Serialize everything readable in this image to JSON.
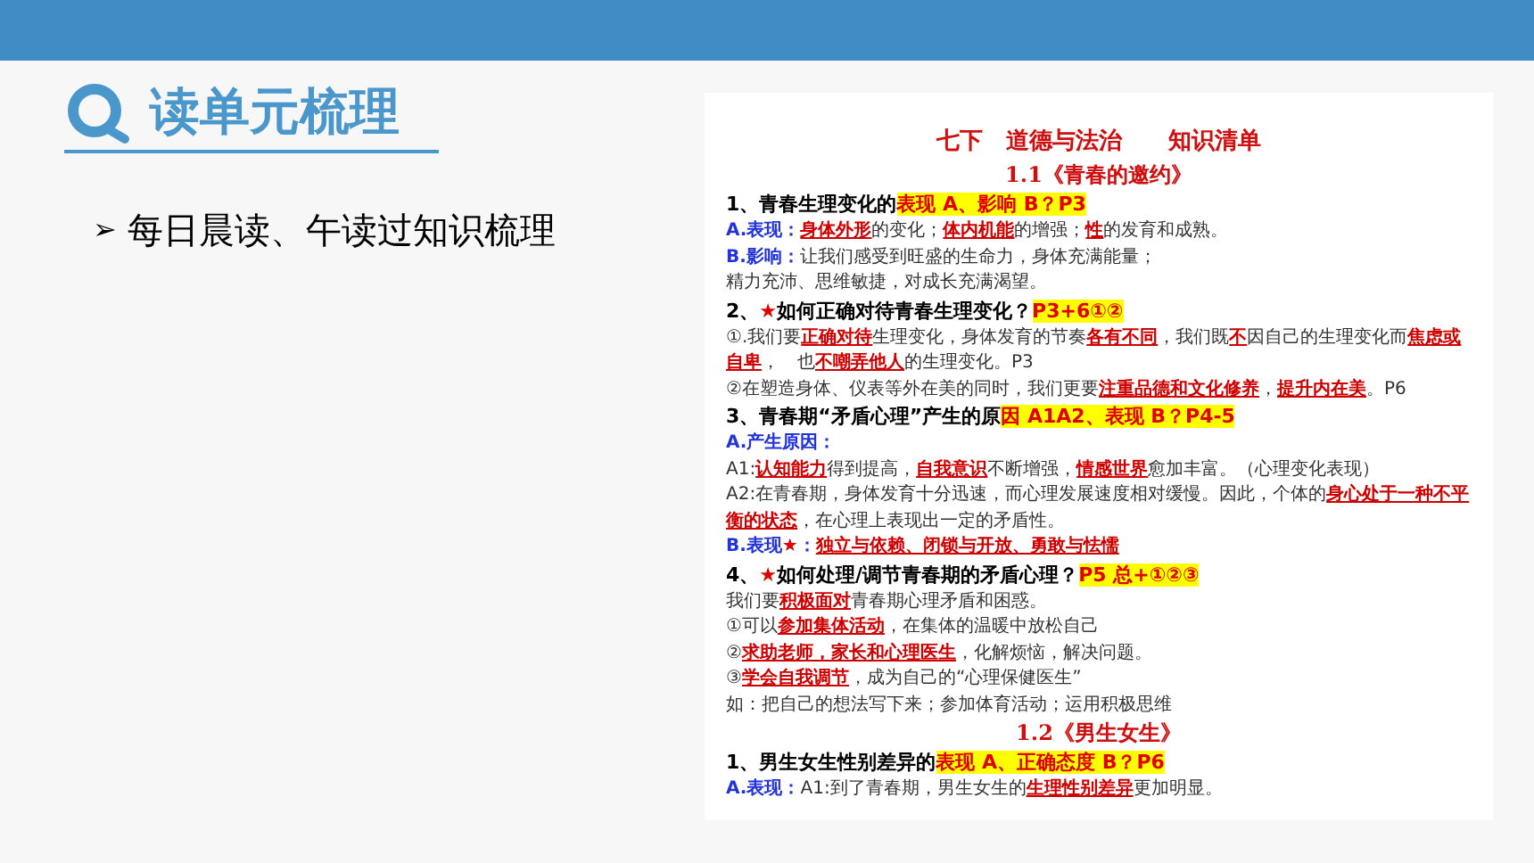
{
  "slide": {
    "title": "读单元梳理",
    "bullet": {
      "marker": "➢",
      "text": "每日晨读、午读过知识梳理"
    }
  },
  "document": {
    "title": "七下　道德与法治　　知识清单",
    "blocks": [
      {
        "kind": "section",
        "segments": [
          {
            "kind": "plain",
            "text": "1.1《青春的邀约》"
          }
        ]
      },
      {
        "kind": "heading",
        "segments": [
          {
            "kind": "plain",
            "text": "1、青春生理变化的"
          },
          {
            "kind": "hl",
            "text": "表现 A、影响 B？P3"
          }
        ]
      },
      {
        "kind": "text",
        "segments": [
          {
            "kind": "label",
            "text": "A.表现："
          },
          {
            "kind": "key",
            "text": "身体外形"
          },
          {
            "kind": "plain",
            "text": "的变化；"
          },
          {
            "kind": "key",
            "text": "体内机能"
          },
          {
            "kind": "plain",
            "text": "的增强；"
          },
          {
            "kind": "key",
            "text": "性"
          },
          {
            "kind": "plain",
            "text": "的发育和成熟。"
          }
        ]
      },
      {
        "kind": "text",
        "segments": [
          {
            "kind": "label",
            "text": "B.影响："
          },
          {
            "kind": "plain",
            "text": "让我们感受到旺盛的生命力，身体充满能量；"
          }
        ]
      },
      {
        "kind": "text",
        "segments": [
          {
            "kind": "plain",
            "text": "精力充沛、思维敏捷，对成长充满渴望。"
          }
        ]
      },
      {
        "kind": "heading",
        "segments": [
          {
            "kind": "plain",
            "text": "2、"
          },
          {
            "kind": "star",
            "text": "★"
          },
          {
            "kind": "plain",
            "text": "如何正确对待青春生理变化？"
          },
          {
            "kind": "hl",
            "text": "P3+6①②"
          }
        ]
      },
      {
        "kind": "text",
        "segments": [
          {
            "kind": "plain",
            "text": "①.我们要"
          },
          {
            "kind": "key",
            "text": "正确对待"
          },
          {
            "kind": "plain",
            "text": "生理变化，身体发育的节奏"
          },
          {
            "kind": "key",
            "text": "各有不同"
          },
          {
            "kind": "plain",
            "text": "，我们既"
          },
          {
            "kind": "key",
            "text": "不"
          },
          {
            "kind": "plain",
            "text": "因自己的生理变化而"
          },
          {
            "kind": "key",
            "text": "焦虑或自卑"
          },
          {
            "kind": "plain",
            "text": "，　也"
          },
          {
            "kind": "key",
            "text": "不嘲弄他人"
          },
          {
            "kind": "plain",
            "text": "的生理变化。P3"
          }
        ]
      },
      {
        "kind": "text",
        "segments": [
          {
            "kind": "plain",
            "text": "②在塑造身体、仪表等外在美的同时，我们更要"
          },
          {
            "kind": "key",
            "text": "注重品德和文化修养"
          },
          {
            "kind": "plain",
            "text": "，"
          },
          {
            "kind": "key",
            "text": "提升内在美"
          },
          {
            "kind": "plain",
            "text": "。P6"
          }
        ]
      },
      {
        "kind": "heading",
        "segments": [
          {
            "kind": "plain",
            "text": "3、青春期“矛盾心理”产生的原"
          },
          {
            "kind": "hl",
            "text": "因 A1A2、表现 B？P4-5"
          }
        ]
      },
      {
        "kind": "text",
        "segments": [
          {
            "kind": "label",
            "text": "A.产生原因："
          }
        ]
      },
      {
        "kind": "text",
        "segments": [
          {
            "kind": "plain",
            "text": "A1:"
          },
          {
            "kind": "key",
            "text": "认知能力"
          },
          {
            "kind": "plain",
            "text": "得到提高，"
          },
          {
            "kind": "key",
            "text": "自我意识"
          },
          {
            "kind": "plain",
            "text": "不断增强，"
          },
          {
            "kind": "key",
            "text": "情感世界"
          },
          {
            "kind": "plain",
            "text": "愈加丰富。（心理变化表现）"
          }
        ]
      },
      {
        "kind": "text",
        "segments": [
          {
            "kind": "plain",
            "text": "A2:在青春期，身体发育十分迅速，而心理发展速度相对缓慢。因此，个体的"
          },
          {
            "kind": "key",
            "text": "身心处于一种不平衡的状态"
          },
          {
            "kind": "plain",
            "text": "，在心理上表现出一定的矛盾性。"
          }
        ]
      },
      {
        "kind": "text",
        "segments": [
          {
            "kind": "label",
            "text": "B.表现"
          },
          {
            "kind": "star",
            "text": "★"
          },
          {
            "kind": "label",
            "text": "："
          },
          {
            "kind": "key",
            "text": "独立与依赖、闭锁与开放、勇敢与怯懦"
          }
        ]
      },
      {
        "kind": "heading",
        "segments": [
          {
            "kind": "plain",
            "text": "4、"
          },
          {
            "kind": "star",
            "text": "★"
          },
          {
            "kind": "plain",
            "text": "如何处理/调节青春期的矛盾心理？"
          },
          {
            "kind": "hl",
            "text": "P5 总+①②③"
          }
        ]
      },
      {
        "kind": "text",
        "segments": [
          {
            "kind": "plain",
            "text": "我们要"
          },
          {
            "kind": "key",
            "text": "积极面对"
          },
          {
            "kind": "plain",
            "text": "青春期心理矛盾和困惑。"
          }
        ]
      },
      {
        "kind": "text",
        "segments": [
          {
            "kind": "plain",
            "text": "①可以"
          },
          {
            "kind": "key",
            "text": "参加集体活动"
          },
          {
            "kind": "plain",
            "text": "，在集体的温暖中放松自己"
          }
        ]
      },
      {
        "kind": "text",
        "segments": [
          {
            "kind": "plain",
            "text": "②"
          },
          {
            "kind": "key",
            "text": "求助老师，家长和心理医生"
          },
          {
            "kind": "plain",
            "text": "，化解烦恼，解决问题。"
          }
        ]
      },
      {
        "kind": "text",
        "segments": [
          {
            "kind": "plain",
            "text": "③"
          },
          {
            "kind": "key",
            "text": "学会自我调节"
          },
          {
            "kind": "plain",
            "text": "，成为自己的“心理保健医生”"
          }
        ]
      },
      {
        "kind": "text",
        "segments": [
          {
            "kind": "plain",
            "text": "如：把自己的想法写下来；参加体育活动；运用积极思维"
          }
        ]
      },
      {
        "kind": "section",
        "segments": [
          {
            "kind": "plain",
            "text": "1.2《男生女生》"
          }
        ]
      },
      {
        "kind": "heading",
        "segments": [
          {
            "kind": "plain",
            "text": "1、男生女生性别差异的"
          },
          {
            "kind": "hl",
            "text": "表现 A、正确态度 B？P6"
          }
        ]
      },
      {
        "kind": "text",
        "segments": [
          {
            "kind": "label",
            "text": "A.表现："
          },
          {
            "kind": "plain",
            "text": "A1:到了青春期，男生女生的"
          },
          {
            "kind": "key",
            "text": "生理性别差异"
          },
          {
            "kind": "plain",
            "text": "更加明显。"
          }
        ]
      }
    ]
  }
}
